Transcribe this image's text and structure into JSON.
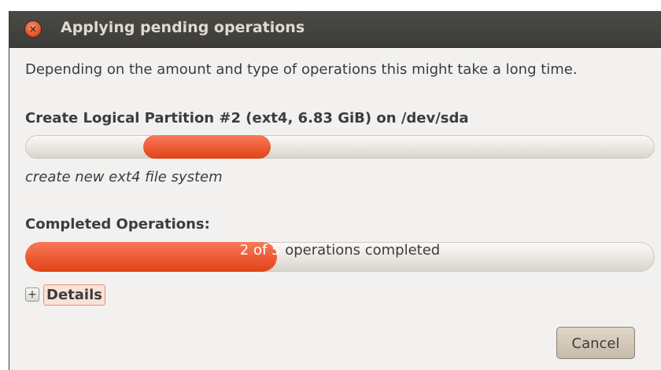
{
  "window": {
    "title": "Applying pending operations",
    "close_symbol": "×"
  },
  "description": "Depending on the amount and type of operations this might take a long time.",
  "current_operation": {
    "title": "Create Logical Partition #2 (ext4, 6.83 GiB) on /dev/sda",
    "subtask": "create new ext4 file system",
    "indeterminate": true
  },
  "completed": {
    "label": "Completed Operations:",
    "done": 2,
    "total": 5,
    "text_done": "2 of 5",
    "text_rest": " operations completed"
  },
  "details": {
    "expander_symbol": "+",
    "label": "Details"
  },
  "buttons": {
    "cancel": "Cancel"
  },
  "colors": {
    "accent": "#ec5a34",
    "titlebar": "#3d3c38",
    "window_bg": "#f2f1f0"
  },
  "icons": {
    "close": "close-icon",
    "expander": "plus-icon"
  }
}
